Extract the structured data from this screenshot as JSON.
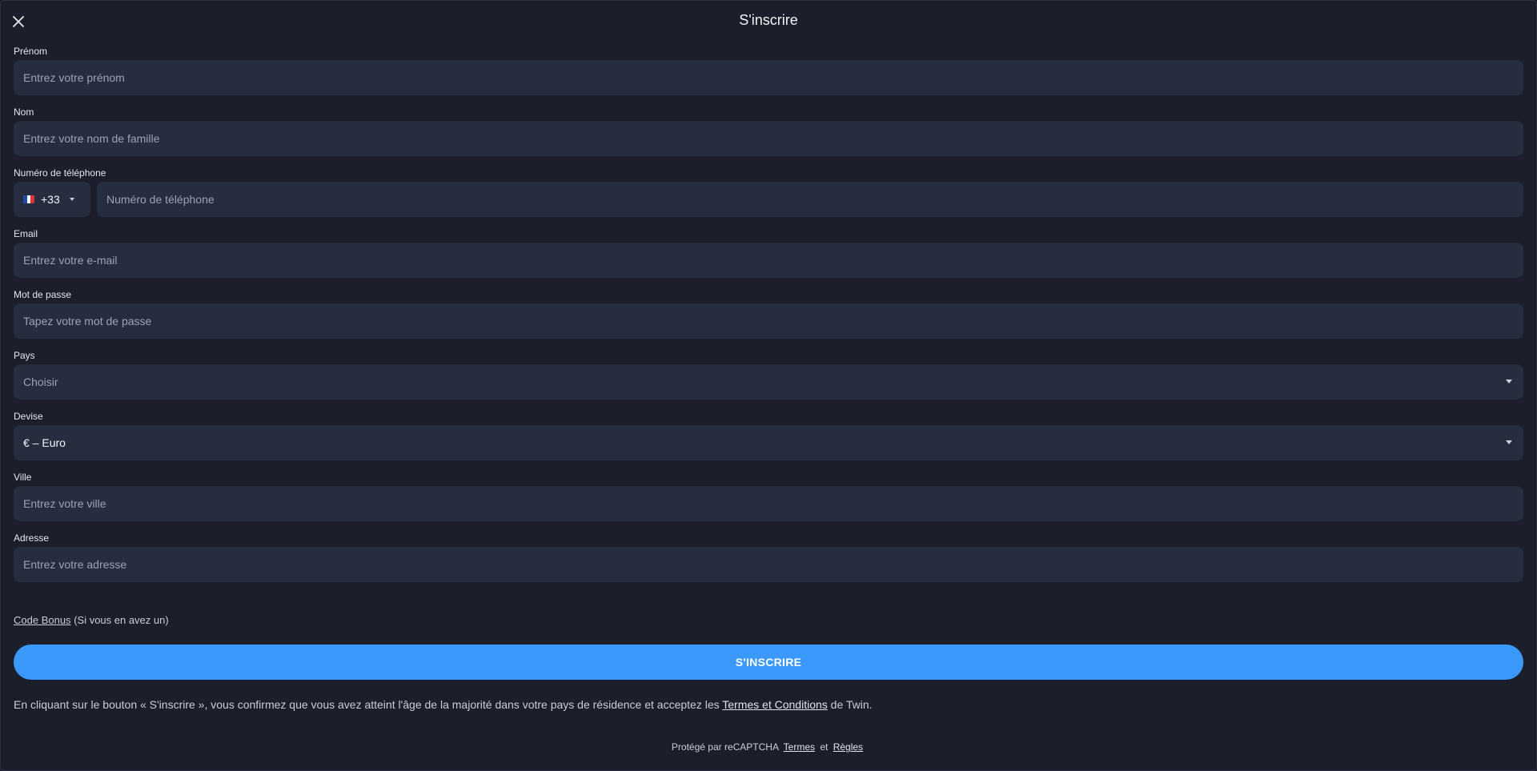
{
  "header": {
    "title": "S'inscrire",
    "close_icon": "close-icon"
  },
  "fields": {
    "first_name": {
      "label": "Prénom",
      "placeholder": "Entrez votre prénom"
    },
    "last_name": {
      "label": "Nom",
      "placeholder": "Entrez votre nom de famille"
    },
    "phone": {
      "label": "Numéro de téléphone",
      "country_code": "+33",
      "country_flag": "france-flag-icon",
      "placeholder": "Numéro de téléphone"
    },
    "email": {
      "label": "Email",
      "placeholder": "Entrez votre e-mail"
    },
    "password": {
      "label": "Mot de passe",
      "placeholder": "Tapez votre mot de passe"
    },
    "country": {
      "label": "Pays",
      "placeholder": "Choisir"
    },
    "currency": {
      "label": "Devise",
      "value": "€ – Euro"
    },
    "city": {
      "label": "Ville",
      "placeholder": "Entrez votre ville"
    },
    "address": {
      "label": "Adresse",
      "placeholder": "Entrez votre adresse"
    }
  },
  "bonus": {
    "link": "Code Bonus",
    "note": "(Si vous en avez un)"
  },
  "submit_label": "S'INSCRIRE",
  "terms": {
    "prefix": "En cliquant sur le bouton « S'inscrire », vous confirmez que vous avez atteint l'âge de la majorité dans votre pays de résidence et acceptez les",
    "link": "Termes et Conditions",
    "suffix": "de Twin."
  },
  "recaptcha": {
    "prefix": "Protégé par reCAPTCHA",
    "terms_link": "Termes",
    "conjunction": "et",
    "rules_link": "Règles"
  },
  "colors": {
    "background": "#1c1f2b",
    "input_bg": "#252d3e",
    "accent": "#3a99fb"
  }
}
